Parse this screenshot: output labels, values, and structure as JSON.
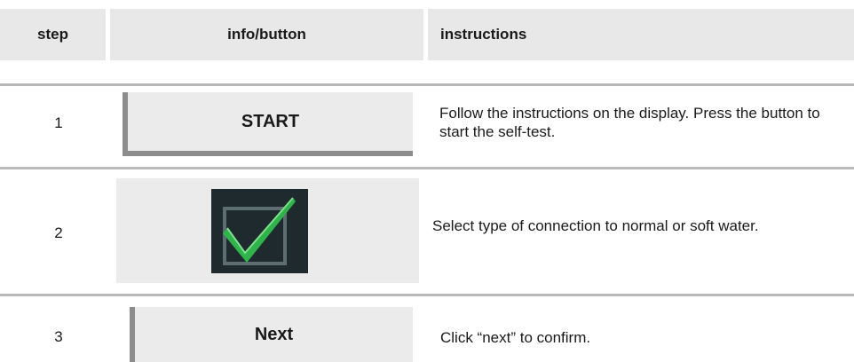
{
  "table": {
    "headers": {
      "step": "step",
      "info": "info/button",
      "instructions": "instructions"
    },
    "rows": [
      {
        "step": "1",
        "button_label": "START",
        "instruction": "Follow the instructions on the display. Press the button to start the self-test."
      },
      {
        "step": "2",
        "icon": "checkmark-checkbox-icon",
        "instruction": "Select type of connection to normal or soft water."
      },
      {
        "step": "3",
        "button_label": "Next",
        "instruction": "Click “next” to confirm."
      }
    ]
  },
  "colors": {
    "header_bg": "#e8e8e8",
    "button_bg": "#ebebeb",
    "button_shadow": "#8c8c8c",
    "check_green": "#2fb34a",
    "icon_bg": "#1f2a2e"
  }
}
